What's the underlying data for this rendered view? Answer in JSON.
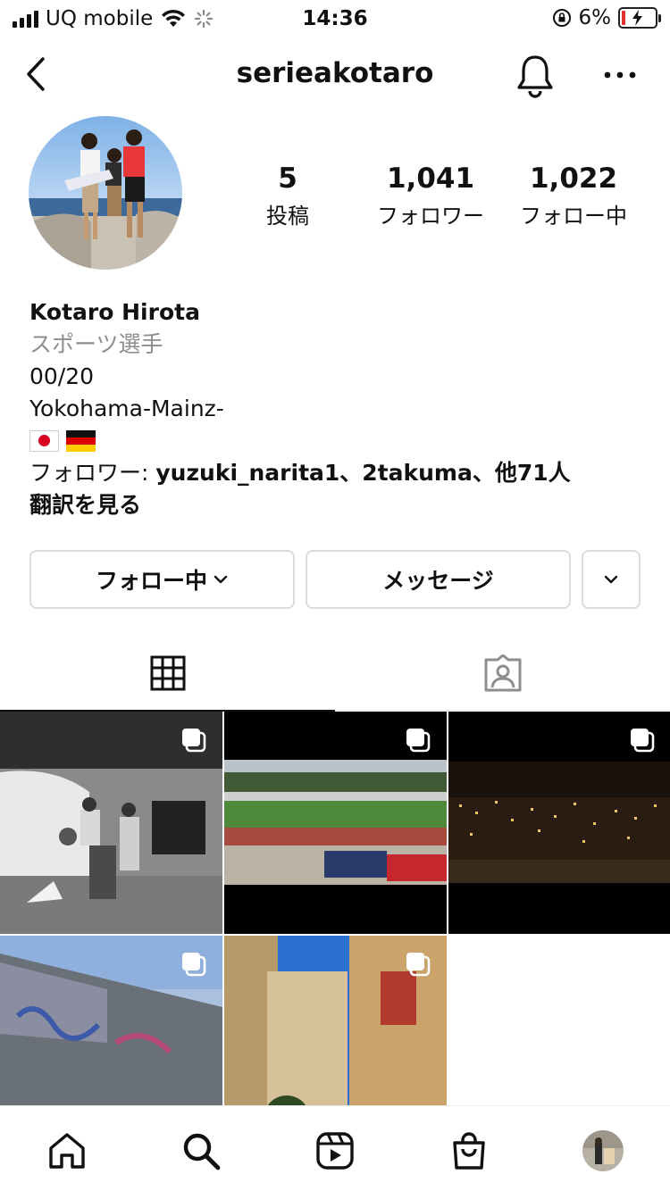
{
  "status_bar": {
    "carrier": "UQ mobile",
    "time": "14:36",
    "battery": "6%"
  },
  "header": {
    "username": "serieakotaro"
  },
  "stats": {
    "posts": {
      "count": "5",
      "label": "投稿"
    },
    "followers": {
      "count": "1,041",
      "label": "フォロワー"
    },
    "following": {
      "count": "1,022",
      "label": "フォロー中"
    }
  },
  "bio": {
    "name": "Kotaro Hirota",
    "category": "スポーツ選手",
    "line1": "00/20",
    "line2": "Yokohama-Mainz-",
    "followed_by_prefix": "フォロワー: ",
    "followed_by_names": "yuzuki_narita1、2takuma、他71人",
    "translate": "翻訳を見る"
  },
  "actions": {
    "following_button": "フォロー中",
    "message_button": "メッセージ"
  },
  "colors": {
    "category_gray": "#8e8e8e",
    "border": "#dbdbdb",
    "battery_low": "#e0302e"
  }
}
